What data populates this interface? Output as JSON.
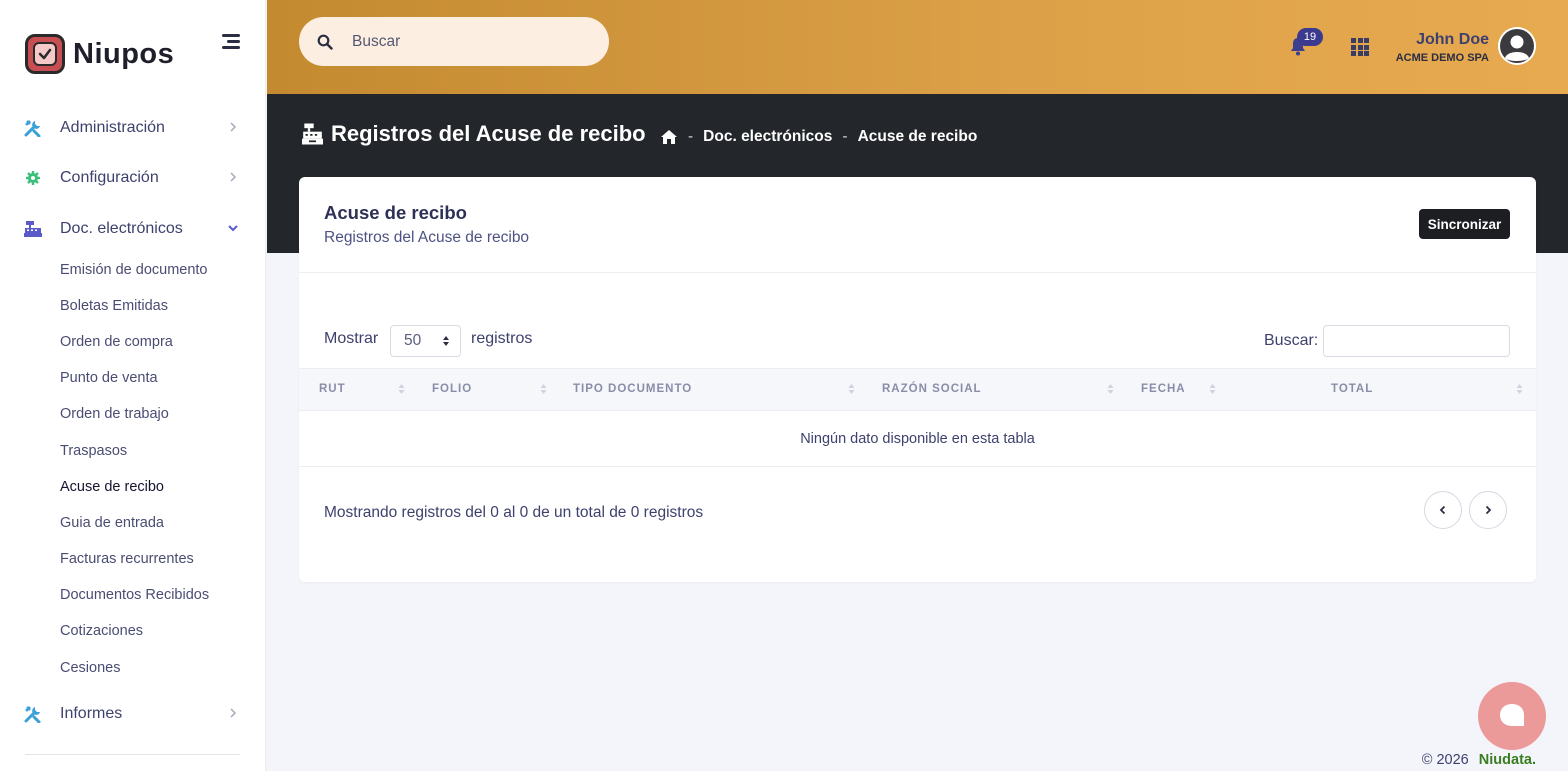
{
  "brand": {
    "name": "Niupos",
    "accent": "#c94e54"
  },
  "sidebar": {
    "items": [
      {
        "label": "Administración",
        "icon": "tools-icon",
        "color": "#3aa0d8"
      },
      {
        "label": "Configuración",
        "icon": "gear-icon",
        "color": "#3cbf7a"
      },
      {
        "label": "Doc. electrónicos",
        "icon": "cash-register-icon",
        "color": "#5a5bc8",
        "expanded": true
      },
      {
        "label": "Informes",
        "icon": "tools-icon",
        "color": "#3aa0d8"
      }
    ],
    "sub_items": [
      {
        "label": "Emisión de documento"
      },
      {
        "label": "Boletas Emitidas"
      },
      {
        "label": "Orden de compra"
      },
      {
        "label": "Punto de venta"
      },
      {
        "label": "Orden de trabajo"
      },
      {
        "label": "Traspasos"
      },
      {
        "label": "Acuse de recibo",
        "active": true
      },
      {
        "label": "Guia de entrada"
      },
      {
        "label": "Facturas recurrentes"
      },
      {
        "label": "Documentos Recibidos"
      },
      {
        "label": "Cotizaciones"
      },
      {
        "label": "Cesiones"
      }
    ]
  },
  "header": {
    "search_placeholder": "Buscar",
    "notifications_count": "19",
    "user_name": "John Doe",
    "user_company": "ACME DEMO SPA",
    "gradient_from": "#c48a30",
    "gradient_to": "#e8aa50"
  },
  "page": {
    "title": "Registros del Acuse de recibo",
    "breadcrumb": [
      "Doc. electrónicos",
      "Acuse de recibo"
    ],
    "breadcrumb_sep": "-"
  },
  "card": {
    "title": "Acuse de recibo",
    "subtitle": "Registros del Acuse de recibo",
    "sync_label": "Sincronizar",
    "show_label": "Mostrar",
    "page_length": "50",
    "records_label": "registros",
    "filter_label": "Buscar:",
    "columns": [
      "RUT",
      "FOLIO",
      "TIPO DOCUMENTO",
      "RAZÓN SOCIAL",
      "FECHA",
      "TOTAL"
    ],
    "empty_message": "Ningún dato disponible en esta tabla",
    "info": "Mostrando registros del 0 al 0 de un total de 0 registros"
  },
  "footer": {
    "copyright": "© 2026",
    "brand_link": "Niudata."
  }
}
